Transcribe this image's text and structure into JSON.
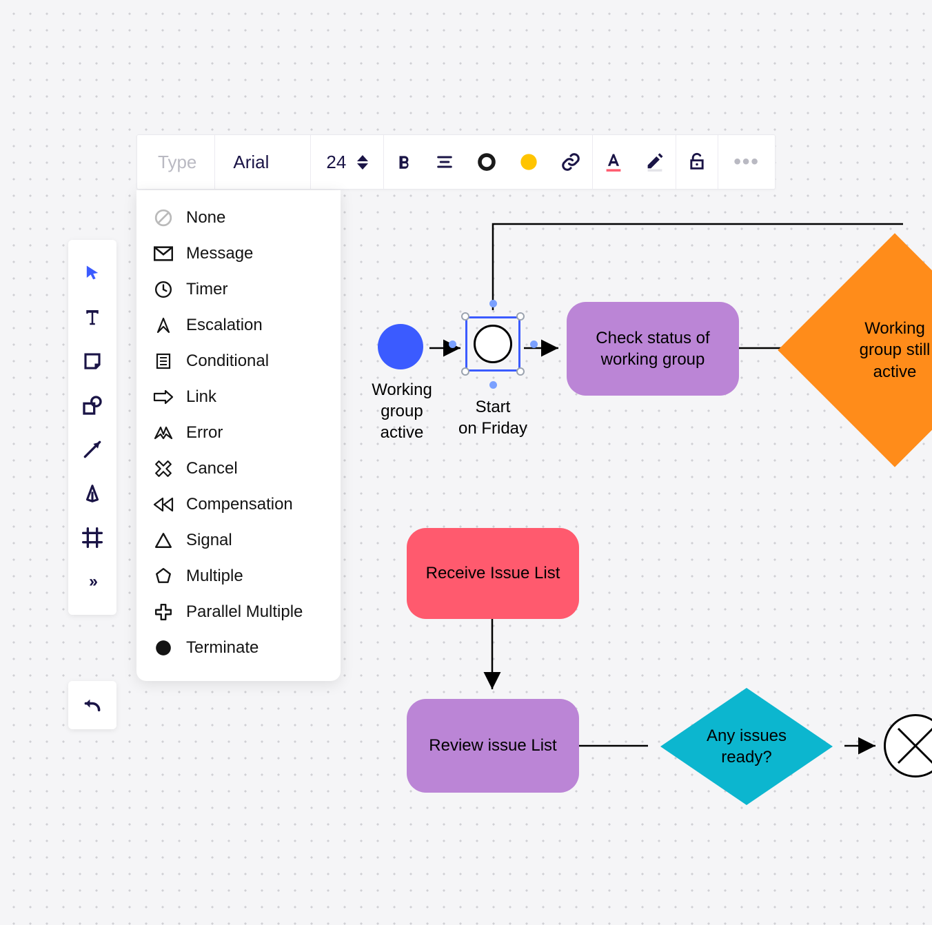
{
  "toolbar": {
    "type_label": "Type",
    "font": "Arial",
    "font_size": "24"
  },
  "dropdown": {
    "items": [
      {
        "icon": "none",
        "label": "None"
      },
      {
        "icon": "message",
        "label": "Message"
      },
      {
        "icon": "timer",
        "label": "Timer"
      },
      {
        "icon": "escalation",
        "label": "Escalation"
      },
      {
        "icon": "conditional",
        "label": "Conditional"
      },
      {
        "icon": "link",
        "label": "Link"
      },
      {
        "icon": "error",
        "label": "Error"
      },
      {
        "icon": "cancel",
        "label": "Cancel"
      },
      {
        "icon": "compensation",
        "label": "Compensation"
      },
      {
        "icon": "signal",
        "label": "Signal"
      },
      {
        "icon": "multiple",
        "label": "Multiple"
      },
      {
        "icon": "parallel-multiple",
        "label": "Parallel Multiple"
      },
      {
        "icon": "terminate",
        "label": "Terminate"
      }
    ]
  },
  "nodes": {
    "start_event": {
      "label": "Working\ngroup\nactive"
    },
    "timer_event": {
      "label": "Start\non Friday"
    },
    "check_status": {
      "label": "Check status of working group",
      "color": "#bb85d6"
    },
    "working_group_active": {
      "label": "Working\ngroup still\nactive",
      "color": "#ff8c1a"
    },
    "receive_issue": {
      "label": "Receive Issue List",
      "color": "#ff5a6e"
    },
    "review_issue": {
      "label": "Review issue List",
      "color": "#bb85d6"
    },
    "any_issues": {
      "label": "Any issues\nready?",
      "color": "#0cb6cf"
    }
  },
  "colors": {
    "accent": "#1a1446",
    "brand_blue": "#3b5bff",
    "yellow": "#ffc400"
  }
}
